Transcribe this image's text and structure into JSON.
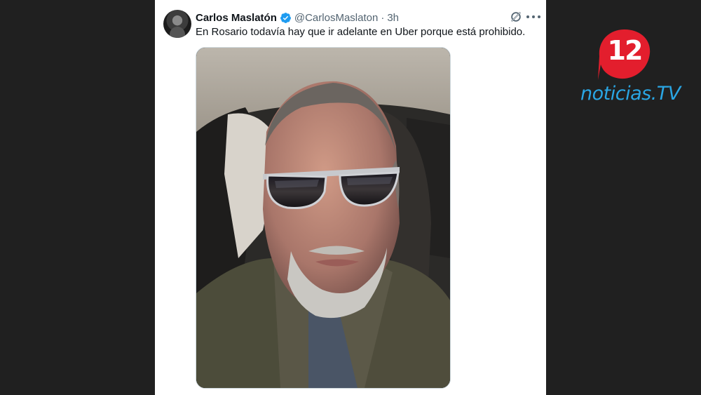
{
  "tweet": {
    "display_name": "Carlos Maslatón",
    "handle": "@CarlosMaslaton",
    "separator": "·",
    "time": "3h",
    "text": "En Rosario todavía hay que ir adelante en Uber porque está prohibido.",
    "verified_icon": "verified-badge-icon",
    "grok_icon": "grok-icon",
    "more_icon": "more-options-icon",
    "verified_color": "#1d9bf0"
  },
  "logo": {
    "number": "12",
    "text": "noticias.TV",
    "badge_color": "#e31e2d",
    "text_color": "#2aa6e4"
  }
}
